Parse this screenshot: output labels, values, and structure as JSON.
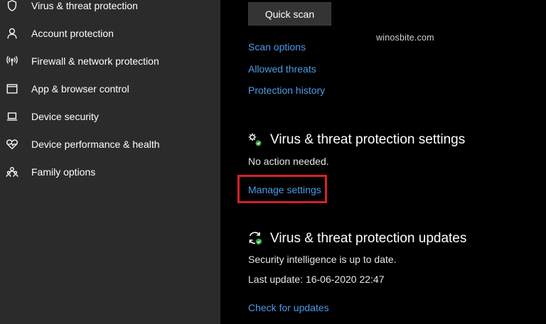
{
  "sidebar": {
    "items": [
      {
        "label": "Virus & threat protection",
        "icon": "shield-icon"
      },
      {
        "label": "Account protection",
        "icon": "person-icon"
      },
      {
        "label": "Firewall & network protection",
        "icon": "wifi-antenna-icon"
      },
      {
        "label": "App & browser control",
        "icon": "browser-window-icon"
      },
      {
        "label": "Device security",
        "icon": "laptop-icon"
      },
      {
        "label": "Device performance & health",
        "icon": "heart-icon"
      },
      {
        "label": "Family options",
        "icon": "family-icon"
      }
    ]
  },
  "main": {
    "quick_scan_label": "Quick scan",
    "links": {
      "scan_options": "Scan options",
      "allowed_threats": "Allowed threats",
      "protection_history": "Protection history"
    },
    "watermark": "winosbite.com",
    "settings": {
      "title": "Virus & threat protection settings",
      "status": "No action needed.",
      "manage_link": "Manage settings",
      "icon": "gears-check-icon"
    },
    "updates": {
      "title": "Virus & threat protection updates",
      "status": "Security intelligence is up to date.",
      "last_update": "Last update: 16-06-2020 22:47",
      "check_link": "Check for updates",
      "icon": "refresh-check-icon"
    },
    "colors": {
      "link": "#4c9be8",
      "highlight": "#d6202a",
      "check_green": "#2ea043",
      "sidebar_bg": "#2b2b2b"
    }
  }
}
